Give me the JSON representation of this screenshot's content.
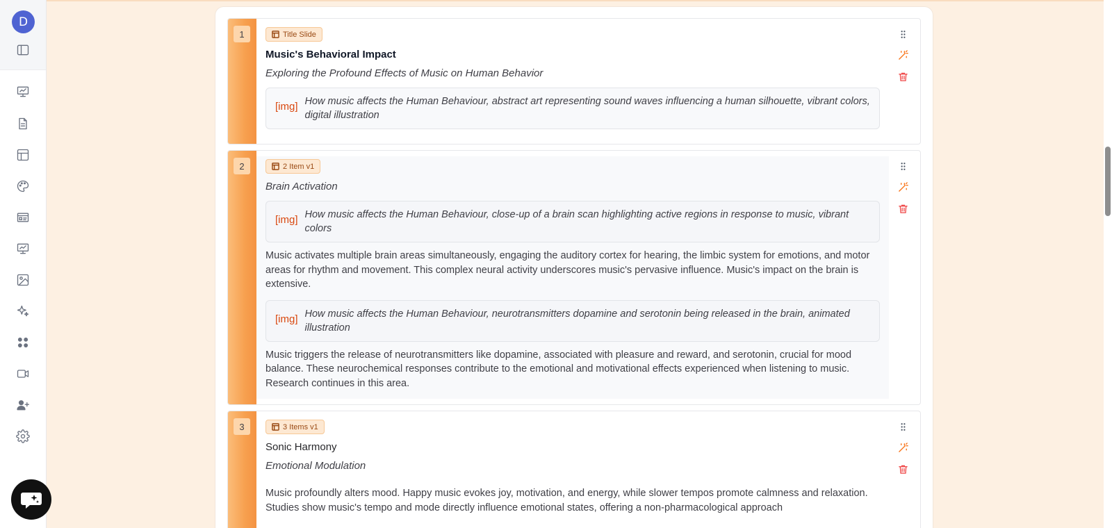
{
  "sidebar": {
    "avatar_initial": "D",
    "icons": [
      "panel-toggle-icon",
      "presentation-chart-icon",
      "document-icon",
      "layout-icon",
      "palette-icon",
      "slides-card-icon",
      "presentation-chart-icon-2",
      "image-icon",
      "sparkles-icon",
      "apps-grid-icon",
      "video-icon",
      "user-plus-icon",
      "settings-gear-icon"
    ]
  },
  "chat": {
    "icon": "chat-sparkle-icon"
  },
  "colors": {
    "accent": "#f49342",
    "badge_bg": "#fde8d2",
    "img_tag": "#d9480f",
    "avatar": "#4f63d2",
    "delete": "#ef4444"
  },
  "slides": [
    {
      "number": "1",
      "layout": "Title Slide",
      "title": "Music's Behavioral Impact",
      "subtitle": "Exploring the Profound Effects of Music on Human Behavior",
      "img_tag": "[img]",
      "image_prompt": "How music affects the Human Behaviour, abstract art representing sound waves influencing a human silhouette, vibrant colors, digital illustration"
    },
    {
      "number": "2",
      "layout": "2 Item v1",
      "subtitle": "Brain Activation",
      "img_tag": "[img]",
      "image_prompt_1": "How music affects the Human Behaviour, close-up of a brain scan highlighting active regions in response to music, vibrant colors",
      "text_1": "Music activates multiple brain areas simultaneously, engaging the auditory cortex for hearing, the limbic system for emotions, and motor areas for rhythm and movement. This complex neural activity underscores music's pervasive influence. Music's impact on the brain is extensive.",
      "image_prompt_2": "How music affects the Human Behaviour, neurotransmitters dopamine and serotonin being released in the brain, animated illustration",
      "text_2": "Music triggers the release of neurotransmitters like dopamine, associated with pleasure and reward, and serotonin, crucial for mood balance. These neurochemical responses contribute to the emotional and motivational effects experienced when listening to music. Research continues in this area."
    },
    {
      "number": "3",
      "layout": "3 Items v1",
      "title": "Sonic Harmony",
      "subtitle": "Emotional Modulation",
      "text_1": "Music profoundly alters mood. Happy music evokes joy, motivation, and energy, while slower tempos promote calmness and relaxation. Studies show music's tempo and mode directly influence emotional states, offering a non-pharmacological approach"
    }
  ]
}
